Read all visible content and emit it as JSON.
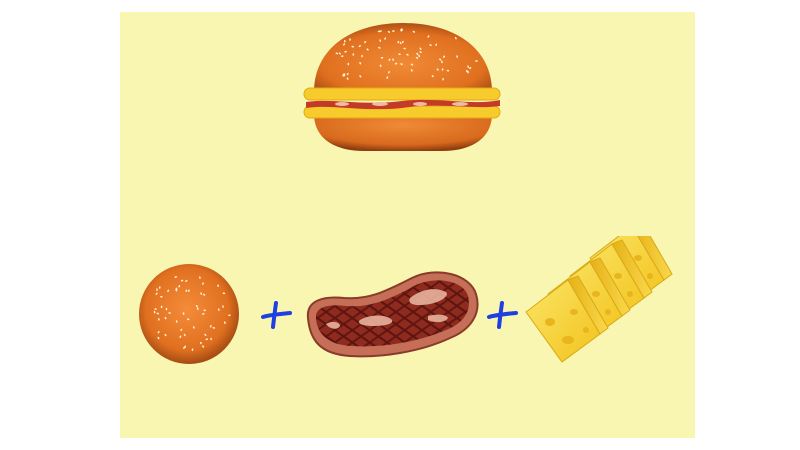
{
  "colors": {
    "background": "#f8f6b0",
    "bun": "#e8742a",
    "bun_dark": "#b5541c",
    "sesame": "#fff3d4",
    "cheese": "#f7d534",
    "cheese_dark": "#d9a915",
    "meat": "#8e2a1e",
    "meat_fat": "#e8b39d",
    "plus": "#1f3fe0"
  },
  "items": [
    {
      "name": "hamburger",
      "icon": "hamburger-icon"
    },
    {
      "name": "bun",
      "icon": "bun-icon"
    },
    {
      "name": "plus",
      "icon": "plus-sign"
    },
    {
      "name": "steak",
      "icon": "steak-icon"
    },
    {
      "name": "plus",
      "icon": "plus-sign"
    },
    {
      "name": "cheese",
      "icon": "cheese-icon"
    }
  ]
}
